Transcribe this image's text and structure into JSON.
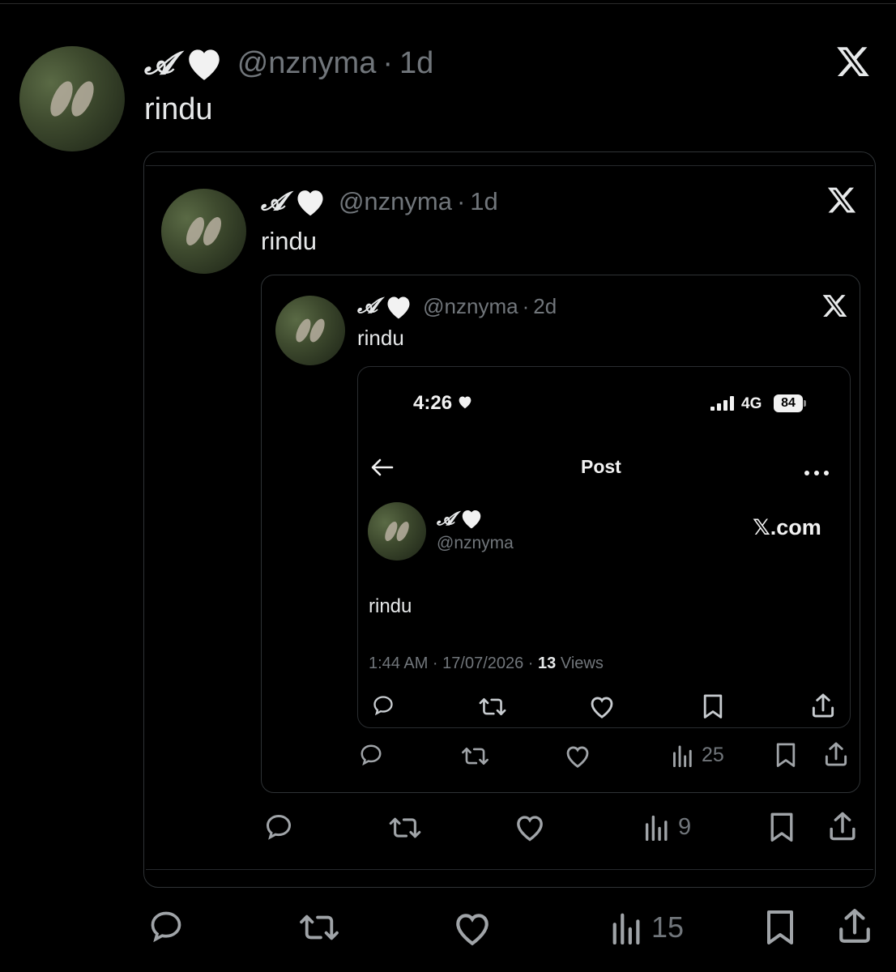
{
  "outer": {
    "display_name": "𝓐",
    "handle": "@nznyma",
    "sep": "·",
    "time": "1d",
    "text": "rindu",
    "actions": {
      "views": "15"
    }
  },
  "mid": {
    "display_name": "𝓐",
    "handle": "@nznyma",
    "sep": "·",
    "time": "1d",
    "text": "rindu",
    "actions": {
      "views": "9"
    }
  },
  "inner": {
    "display_name": "𝓐",
    "handle": "@nznyma",
    "sep": "·",
    "time": "2d",
    "text": "rindu",
    "actions": {
      "views": "25"
    }
  },
  "phone": {
    "status_time": "4:26",
    "network": "4G",
    "battery": "84",
    "header_title": "Post",
    "display_name": "𝓐",
    "handle": "@nznyma",
    "brand": "𝕏.com",
    "text": "rindu",
    "meta_time": "1:44 AM · 17/07/2026 · ",
    "meta_views_num": "13",
    "meta_views_label": " Views"
  },
  "colors": {
    "bg": "#000000",
    "text": "#e7e9ea",
    "muted": "#71767b",
    "border": "#2f3336"
  },
  "icons": [
    "x-logo-icon",
    "heart-icon",
    "reply-icon",
    "retweet-icon",
    "like-icon",
    "views-icon",
    "bookmark-icon",
    "share-icon",
    "back-arrow-icon",
    "more-icon",
    "signal-icon",
    "battery-icon"
  ]
}
